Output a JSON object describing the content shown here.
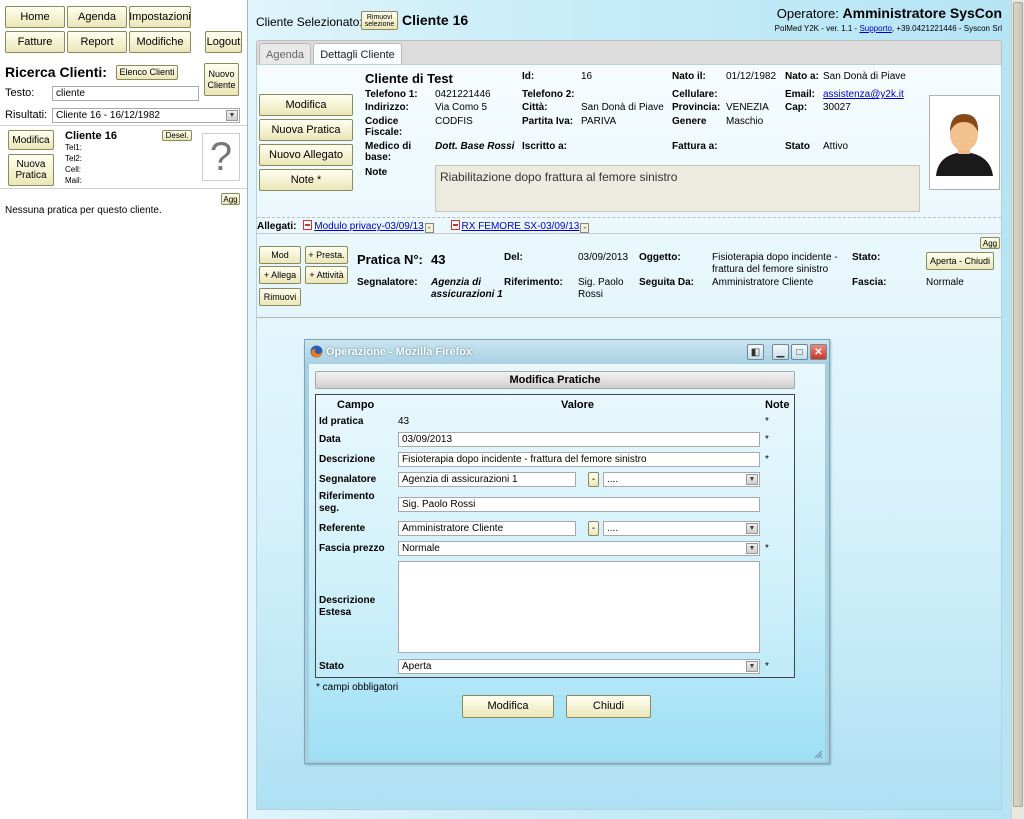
{
  "left": {
    "nav": {
      "home": "Home",
      "agenda": "Agenda",
      "impostazioni": "Impostazioni",
      "fatture": "Fatture",
      "report": "Report",
      "modifiche": "Modifiche",
      "logout": "Logout"
    },
    "search_title": "Ricerca Clienti:",
    "elenco_clienti": "Elenco Clienti",
    "nuovo_cliente": "Nuovo Cliente",
    "testo_label": "Testo:",
    "testo_value": "cliente",
    "risultati_label": "Risultati:",
    "risultati_value": "Cliente 16 - 16/12/1982",
    "card": {
      "modifica": "Modifica",
      "nuova_pratica": "Nuova Pratica",
      "name": "Cliente 16",
      "desel": "Desel.",
      "tel1": "Tel1:",
      "tel2": "Tel2:",
      "cell": "Cell:",
      "mail": "Mail:",
      "photo_placeholder": "?",
      "agg": "Agg"
    },
    "no_pratica": "Nessuna pratica per questo cliente."
  },
  "header": {
    "cliente_selezionato_label": "Cliente Selezionato:",
    "rimuovi_selezione": "Rimuovi selezione",
    "cliente_name": "Cliente 16",
    "operatore_label": "Operatore:",
    "operatore_name": "Amministratore SysCon",
    "version_text": "PolMed Y2K - ver. 1.1 -",
    "supporto_link": "Supporto",
    "version_tail": ", +39.0421221446 - Syscon Srl"
  },
  "tabs": {
    "agenda": "Agenda",
    "dettagli": "Dettagli Cliente"
  },
  "cliente": {
    "buttons": {
      "modifica": "Modifica",
      "nuova_pratica": "Nuova Pratica",
      "nuovo_allegato": "Nuovo Allegato",
      "note": "Note *"
    },
    "name": "Cliente di Test",
    "telefono1_label": "Telefono 1:",
    "telefono1": "0421221446",
    "indirizzo_label": "Indirizzo:",
    "indirizzo": "Via Como 5",
    "codice_label": "Codice Fiscale:",
    "codice": "CODFIS",
    "medico_label": "Medico di base:",
    "medico": "Dott. Base Rossi",
    "note_label": "Note",
    "id_label": "Id:",
    "id": "16",
    "telefono2_label": "Telefono 2:",
    "citta_label": "Città:",
    "citta": "San Donà di Piave",
    "partita_label": "Partita Iva:",
    "partita": "PARIVA",
    "iscritto_label": "Iscritto a:",
    "nato_il_label": "Nato il:",
    "nato_il": "01/12/1982",
    "cellulare_label": "Cellulare:",
    "provincia_label": "Provincia:",
    "provincia": "VENEZIA",
    "genere_label": "Genere",
    "genere": "Maschio",
    "fattura_label": "Fattura a:",
    "nato_a_label": "Nato a:",
    "nato_a": "San Donà di Piave",
    "email_label": "Email:",
    "email": "assistenza@y2k.it",
    "cap_label": "Cap:",
    "cap": "30027",
    "stato_label": "Stato",
    "stato": "Attivo",
    "note_text": "Riabilitazione dopo frattura al femore sinistro"
  },
  "allegati": {
    "label": "Allegati:",
    "file1": "Modulo privacy-03/09/13",
    "file2": "RX FEMORE SX-03/09/13",
    "remove": "-"
  },
  "pratica": {
    "agg": "Agg",
    "buttons": {
      "mod": "Mod",
      "presta": "+ Presta.",
      "allega": "+ Allega",
      "attivita": "+ Attività",
      "rimuovi": "Rimuovi"
    },
    "title": "Pratica N°:",
    "numero": "43",
    "segnalatore_label": "Segnalatore:",
    "segnalatore": "Agenzia di assicurazioni 1",
    "del_label": "Del:",
    "del": "03/09/2013",
    "riferimento_label": "Riferimento:",
    "riferimento": "Sig. Paolo Rossi",
    "oggetto_label": "Oggetto:",
    "oggetto": "Fisioterapia dopo incidente - frattura del femore sinistro",
    "seguita_label": "Seguita Da:",
    "seguita": "Amministratore Cliente",
    "stato_label": "Stato:",
    "stato_btn": "Aperta - Chiudi",
    "fascia_label": "Fascia:",
    "fascia": "Normale"
  },
  "popup": {
    "window_title": "Operazione - Mozilla Firefox",
    "heading": "Modifica Pratiche",
    "col_campo": "Campo",
    "col_valore": "Valore",
    "col_note": "Note",
    "fields": {
      "id_label": "Id pratica",
      "id_value": "43",
      "data_label": "Data",
      "data_value": "03/09/2013",
      "descrizione_label": "Descrizione",
      "descrizione_value": "Fisioterapia dopo incidente - frattura del femore sinistro",
      "segnalatore_label": "Segnalatore",
      "segnalatore_value": "Agenzia di assicurazioni 1",
      "segnalatore_select": "....",
      "riferimento_label": "Riferimento seg.",
      "riferimento_value": "Sig. Paolo Rossi",
      "referente_label": "Referente",
      "referente_value": "Amministratore Cliente",
      "referente_select": "....",
      "fascia_label": "Fascia prezzo",
      "fascia_value": "Normale",
      "estesa_label": "Descrizione Estesa",
      "stato_label": "Stato",
      "stato_value": "Aperta"
    },
    "required_mark": "*",
    "dash": "-",
    "obbligatori": "* campi obbligatori",
    "modifica": "Modifica",
    "chiudi": "Chiudi"
  }
}
